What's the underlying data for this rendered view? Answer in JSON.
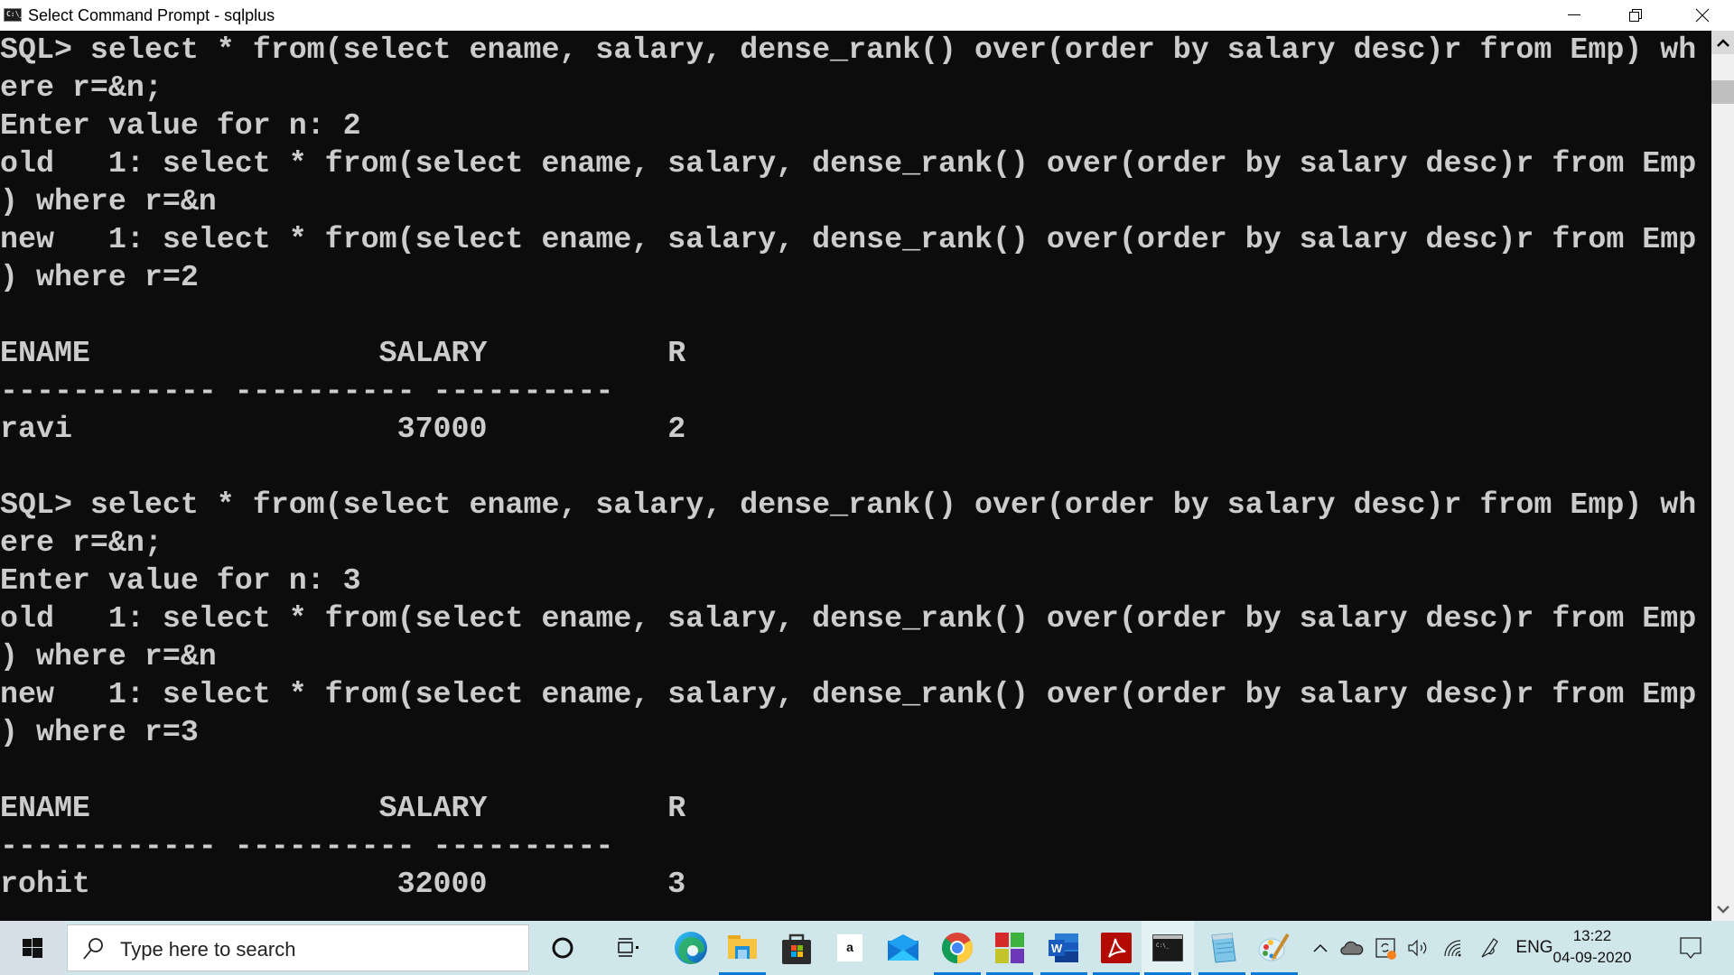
{
  "window": {
    "title": "Select Command Prompt - sqlplus",
    "icon": "cmd-icon",
    "icon_glyph": "C:\\_",
    "controls": [
      "minimize-icon",
      "restore-icon",
      "close-icon"
    ]
  },
  "terminal": {
    "lines": [
      "SQL> select * from(select ename, salary, dense_rank() over(order by salary desc)r from Emp) wh",
      "ere r=&n;",
      "Enter value for n: 2",
      "old   1: select * from(select ename, salary, dense_rank() over(order by salary desc)r from Emp",
      ") where r=&n",
      "new   1: select * from(select ename, salary, dense_rank() over(order by salary desc)r from Emp",
      ") where r=2",
      "",
      "ENAME                SALARY          R",
      "------------ ---------- ----------",
      "ravi                  37000          2",
      "",
      "SQL> select * from(select ename, salary, dense_rank() over(order by salary desc)r from Emp) wh",
      "ere r=&n;",
      "Enter value for n: 3",
      "old   1: select * from(select ename, salary, dense_rank() over(order by salary desc)r from Emp",
      ") where r=&n",
      "new   1: select * from(select ename, salary, dense_rank() over(order by salary desc)r from Emp",
      ") where r=3",
      "",
      "ENAME                SALARY          R",
      "------------ ---------- ----------",
      "rohit                 32000          3"
    ],
    "results": [
      {
        "n": 2,
        "columns": [
          "ENAME",
          "SALARY",
          "R"
        ],
        "rows": [
          [
            "ravi",
            "37000",
            "2"
          ]
        ]
      },
      {
        "n": 3,
        "columns": [
          "ENAME",
          "SALARY",
          "R"
        ],
        "rows": [
          [
            "rohit",
            "32000",
            "3"
          ]
        ]
      }
    ]
  },
  "taskbar": {
    "search_placeholder": "Type here to search",
    "apps": [
      {
        "name": "cortana",
        "icon": "cortana-circle-icon"
      },
      {
        "name": "task-view",
        "icon": "task-view-icon"
      },
      {
        "name": "edge",
        "icon": "edge-icon"
      },
      {
        "name": "file-explorer",
        "icon": "folder-icon",
        "running": true
      },
      {
        "name": "microsoft-store",
        "icon": "store-bag-icon"
      },
      {
        "name": "amazon",
        "icon": "amazon-icon",
        "label": "a"
      },
      {
        "name": "mail",
        "icon": "mail-icon"
      },
      {
        "name": "chrome",
        "icon": "chrome-icon",
        "running": true
      },
      {
        "name": "multicolor-app",
        "icon": "color-blocks-icon",
        "running": true
      },
      {
        "name": "word",
        "icon": "word-icon",
        "label": "W",
        "running": true
      },
      {
        "name": "acrobat",
        "icon": "acrobat-icon",
        "running": true
      },
      {
        "name": "command-prompt",
        "icon": "cmd-icon",
        "running": true,
        "active": true
      },
      {
        "name": "notepad",
        "icon": "notepad-icon",
        "running": true
      },
      {
        "name": "paint",
        "icon": "paint-icon",
        "running": true
      }
    ],
    "tray": {
      "language": "ENG",
      "time": "13:22",
      "date": "04-09-2020"
    }
  },
  "colors": {
    "terminal_bg": "#0c0c0c",
    "terminal_fg": "#cccccc",
    "taskbar_bg": "#cfe6ea",
    "running_indicator": "#0a78d7"
  }
}
